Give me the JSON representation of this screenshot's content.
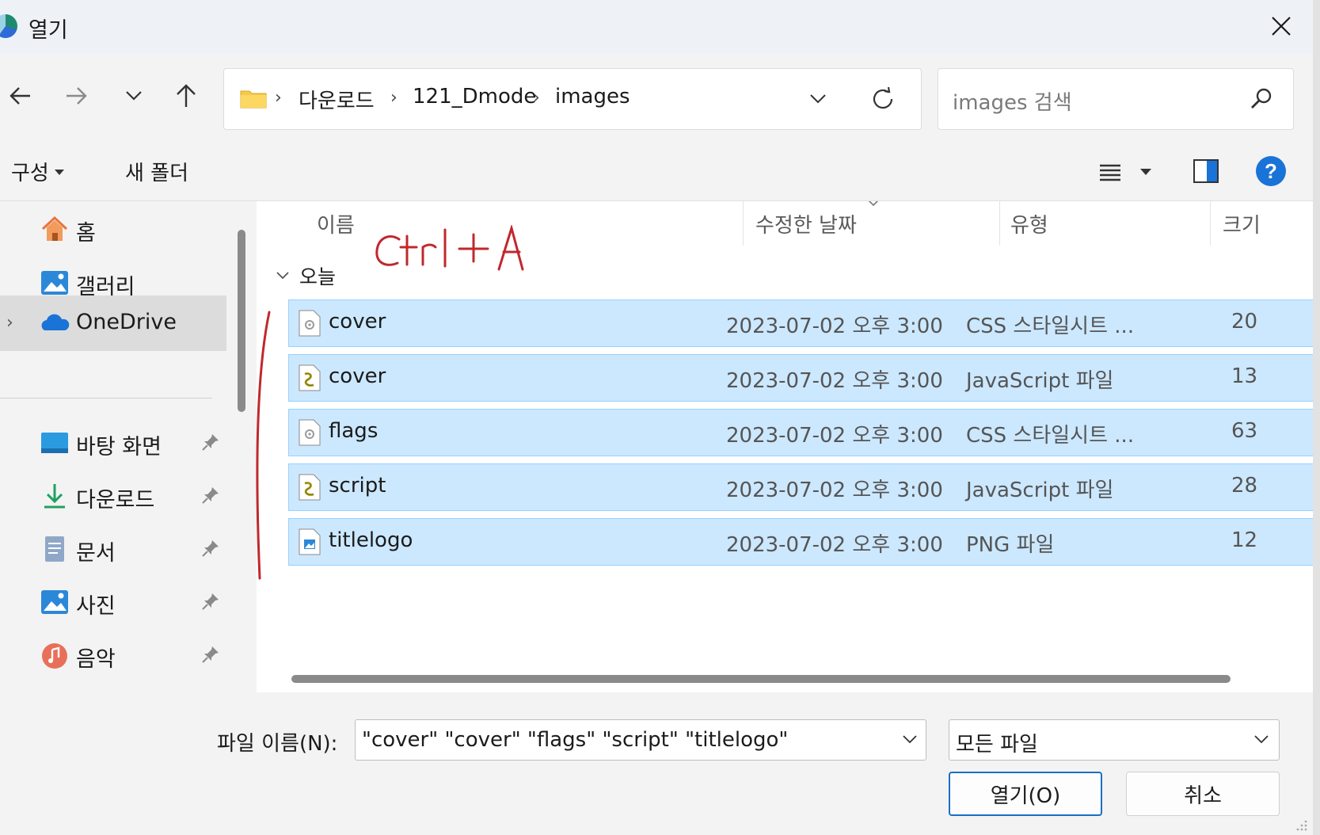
{
  "window": {
    "title": "열기"
  },
  "address": {
    "breadcrumbs": [
      "다운로드",
      "121_Dmode",
      "images"
    ],
    "search_placeholder": "images 검색"
  },
  "toolbar": {
    "organize_label": "구성",
    "new_folder_label": "새 폴더",
    "help_label": "?"
  },
  "sidebar": {
    "items": [
      {
        "label": "홈",
        "icon": "home-icon"
      },
      {
        "label": "갤러리",
        "icon": "gallery-icon"
      },
      {
        "label": "OneDrive",
        "icon": "onedrive-icon",
        "selected": true
      },
      {
        "label": "바탕 화면",
        "icon": "desktop-icon",
        "pinned": true
      },
      {
        "label": "다운로드",
        "icon": "download-icon",
        "pinned": true
      },
      {
        "label": "문서",
        "icon": "document-icon",
        "pinned": true
      },
      {
        "label": "사진",
        "icon": "pictures-icon",
        "pinned": true
      },
      {
        "label": "음악",
        "icon": "music-icon",
        "pinned": true
      }
    ]
  },
  "file_list": {
    "columns": [
      "이름",
      "수정한 날짜",
      "유형",
      "크기"
    ],
    "group": "오늘",
    "rows": [
      {
        "name": "cover",
        "date": "2023-07-02 오후 3:00",
        "type": "CSS 스타일시트 ...",
        "size": "20",
        "icon": "css-file-icon"
      },
      {
        "name": "cover",
        "date": "2023-07-02 오후 3:00",
        "type": "JavaScript 파일",
        "size": "13",
        "icon": "js-file-icon"
      },
      {
        "name": "flags",
        "date": "2023-07-02 오후 3:00",
        "type": "CSS 스타일시트 ...",
        "size": "63",
        "icon": "css-file-icon"
      },
      {
        "name": "script",
        "date": "2023-07-02 오후 3:00",
        "type": "JavaScript 파일",
        "size": "28",
        "icon": "js-file-icon"
      },
      {
        "name": "titlelogo",
        "date": "2023-07-02 오후 3:00",
        "type": "PNG 파일",
        "size": "12",
        "icon": "png-file-icon"
      }
    ],
    "annotation": "Ctrl + A"
  },
  "footer": {
    "filename_label": "파일 이름(N):",
    "filename_value": "\"cover\" \"cover\" \"flags\" \"script\" \"titlelogo\"",
    "filetype_value": "모든 파일",
    "open_label": "열기(O)",
    "cancel_label": "취소"
  },
  "colors": {
    "selection": "#cce8ff",
    "selection_border": "#99d1ff",
    "accent": "#1a73d6",
    "annotation": "#c0282d"
  }
}
